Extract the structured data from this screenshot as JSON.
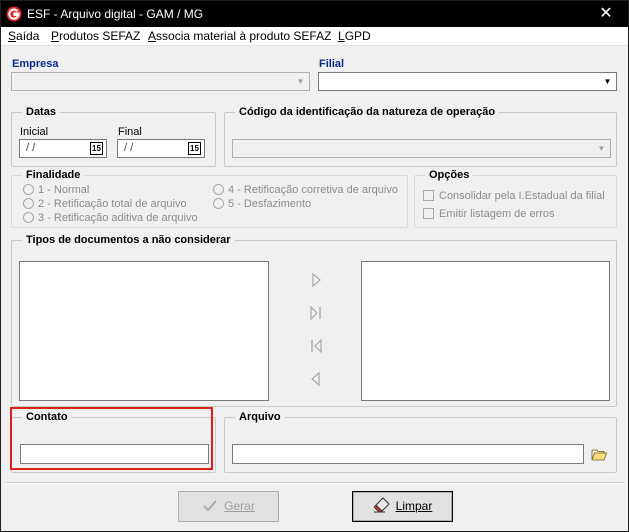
{
  "window": {
    "title": "ESF - Arquivo digital - GAM / MG",
    "close_label": "✕",
    "icon": "app-logo-icon"
  },
  "menu": [
    {
      "label": "Saída",
      "hot": "S"
    },
    {
      "label": "Produtos SEFAZ",
      "hot": "P"
    },
    {
      "label": "Associa material à produto SEFAZ",
      "hot": "A"
    },
    {
      "label": "LGPD",
      "hot": "L"
    }
  ],
  "empresa": {
    "label": "Empresa",
    "value": ""
  },
  "filial": {
    "label": "Filial",
    "value": ""
  },
  "datas": {
    "legend": "Datas",
    "inicial_label": "Inicial",
    "inicial_value": "/ /",
    "final_label": "Final",
    "final_value": "/ /",
    "calendar_icon": "15"
  },
  "codigo": {
    "legend": "Código da identificação da natureza de operação",
    "value": ""
  },
  "finalidade": {
    "legend": "Finalidade",
    "options": [
      "1 - Normal",
      "2 - Retificação total de arquivo",
      "3 - Retificação aditiva de arquivo",
      "4 - Retificação corretiva de arquivo",
      "5 - Desfazimento"
    ]
  },
  "opcoes": {
    "legend": "Opções",
    "options": [
      "Consolidar pela I.Estadual da filial",
      "Emitir listagem de erros"
    ]
  },
  "tipos": {
    "legend": "Tipos de documentos a não considerar"
  },
  "contato": {
    "legend": "Contato",
    "value": ""
  },
  "arquivo": {
    "legend": "Arquivo",
    "value": "",
    "folder_icon": "folder-open-icon"
  },
  "buttons": {
    "gerar": "Gerar",
    "limpar": "Limpar"
  },
  "colors": {
    "highlight": "#e01e1e",
    "titlebar": "#000000",
    "label_blue": "#0a2a8c"
  }
}
